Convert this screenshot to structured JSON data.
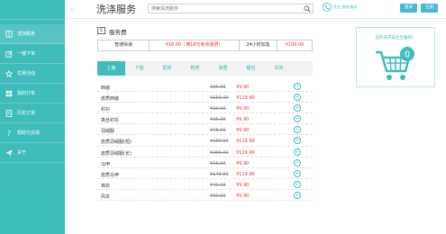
{
  "sidebar": {
    "items": [
      {
        "label": "洗涤服务",
        "icon": "book-icon"
      },
      {
        "label": "一键下单",
        "icon": "pencil-icon"
      },
      {
        "label": "优惠活动",
        "icon": "star-icon"
      },
      {
        "label": "我的订单",
        "icon": "grid-icon"
      },
      {
        "label": "历史订单",
        "icon": "document-icon"
      },
      {
        "label": "帮助与反馈",
        "icon": "question-icon"
      },
      {
        "label": "关于",
        "icon": "send-icon"
      }
    ]
  },
  "header": {
    "collapse": "‹",
    "title": "洗涤服务",
    "search_placeholder": "搜索清洗服务",
    "contact": "专业 热线 服务",
    "login_label": "登录",
    "register_label": "注册"
  },
  "fees": {
    "section_icon": "$",
    "section_title": "服务费",
    "standard_label": "普通快递",
    "standard_price": "¥18.00（满18元免快递费）",
    "express_label": "24小时加急",
    "express_price": "¥100.00"
  },
  "cart": {
    "text": "您的洗衣篮还空着呢！",
    "count": "0"
  },
  "tabs": [
    "上装",
    "下装",
    "配饰",
    "鞋类",
    "家居",
    "睡包",
    "车饰"
  ],
  "items": [
    {
      "name": "西装",
      "old": "¥25.00",
      "new": "¥9.90"
    },
    {
      "name": "皮质西装",
      "old": "¥150.00",
      "new": "¥119.90"
    },
    {
      "name": "衬衫",
      "old": "¥20.00",
      "new": "¥9.90"
    },
    {
      "name": "真丝衬衫",
      "old": "¥25.00",
      "new": "¥9.90"
    },
    {
      "name": "羽绒服",
      "old": "¥48.00",
      "new": "¥9.90"
    },
    {
      "name": "皮质羽绒服(短)",
      "old": "¥180.00",
      "new": "¥119.90"
    },
    {
      "name": "皮质羽绒服(长)",
      "old": "¥200.00",
      "new": "¥119.90"
    },
    {
      "name": "马甲",
      "old": "¥16.00",
      "new": "¥9.90"
    },
    {
      "name": "皮质马甲",
      "old": "¥140.00",
      "new": "¥119.90"
    },
    {
      "name": "棉衣",
      "old": "¥40.00",
      "new": "¥9.90"
    },
    {
      "name": "风衣",
      "old": "¥60.00",
      "new": "¥9.90"
    }
  ],
  "add_symbol": "+"
}
